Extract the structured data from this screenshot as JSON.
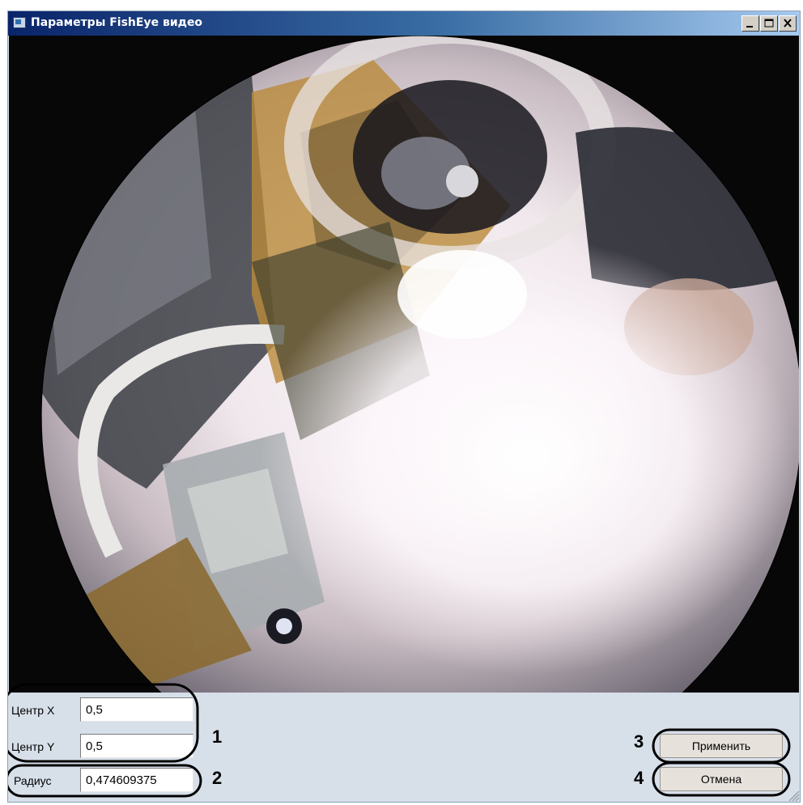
{
  "window": {
    "title": "Параметры FishEye видео",
    "title_icon": "video-window-icon",
    "controls": [
      "minimize-icon",
      "maximize-icon",
      "close-icon"
    ]
  },
  "preview": {
    "content": "fisheye-camera-image",
    "circle_overlay_color": "#000000"
  },
  "fields": {
    "center_x_label": "Центр X",
    "center_x_value": "0,5",
    "center_y_label": "Центр Y",
    "center_y_value": "0,5",
    "radius_label": "Радиус",
    "radius_value": "0,474609375"
  },
  "buttons": {
    "apply_label": "Применить",
    "cancel_label": "Отмена"
  },
  "callouts": {
    "n1": "1",
    "n2": "2",
    "n3": "3",
    "n4": "4"
  },
  "colors": {
    "titlebar_start": "#0a246a",
    "titlebar_end": "#a6caf0",
    "panel_bg": "#d7dfe9"
  }
}
